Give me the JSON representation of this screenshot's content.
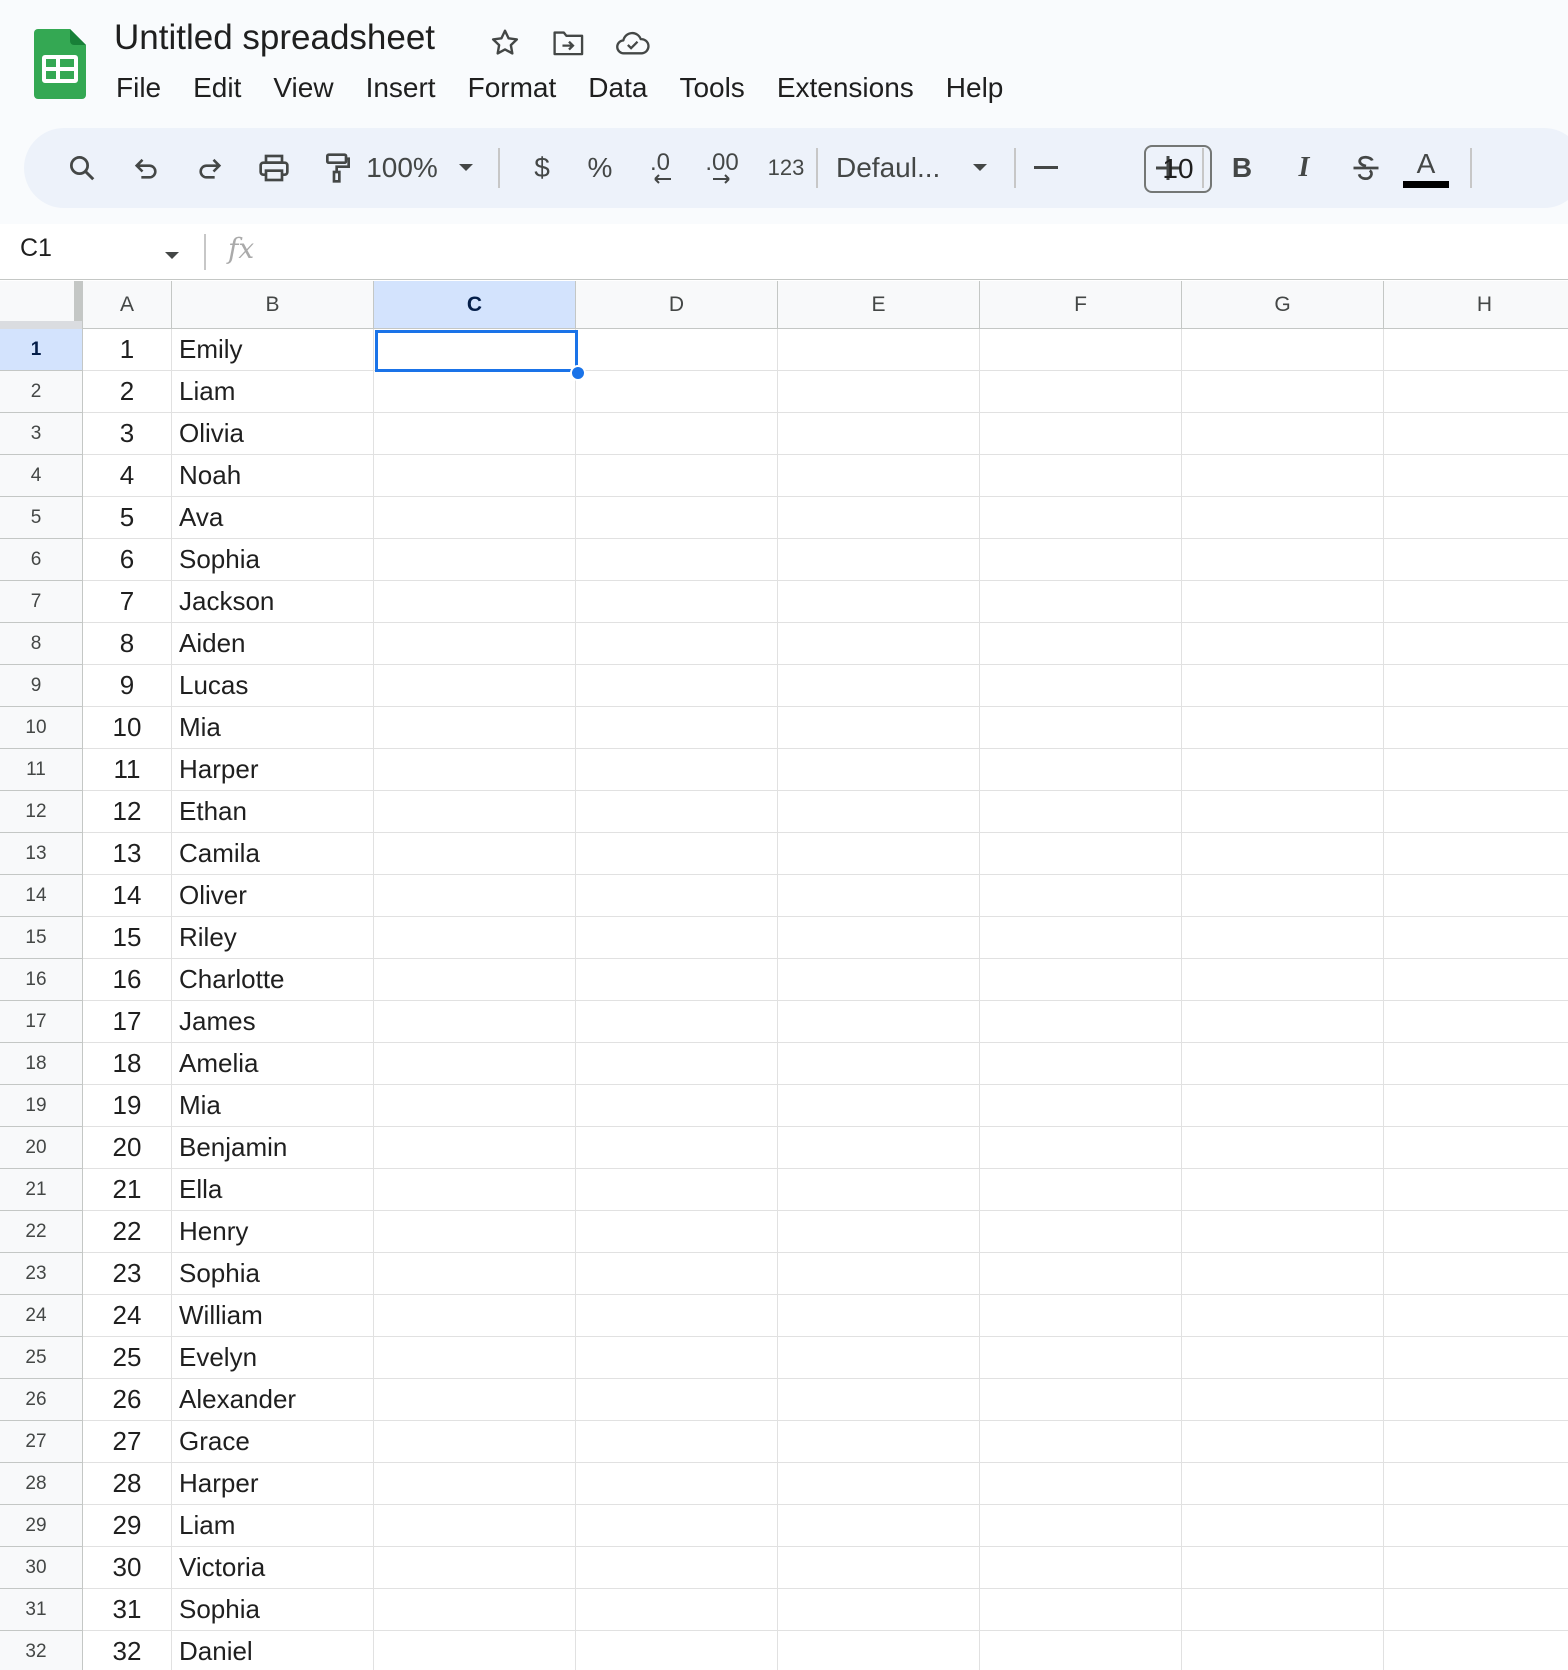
{
  "app": {
    "title": "Untitled spreadsheet",
    "brand_color": "#34a853",
    "accent_color": "#1a73e8",
    "title_icons": [
      "star-icon",
      "move-to-folder-icon",
      "cloud-saved-icon"
    ]
  },
  "menu": [
    "File",
    "Edit",
    "View",
    "Insert",
    "Format",
    "Data",
    "Tools",
    "Extensions",
    "Help"
  ],
  "toolbar": {
    "zoom": "100%",
    "currency": "$",
    "percent": "%",
    "decrease_decimal": ".0",
    "increase_decimal": ".00",
    "more_formats": "123",
    "font": "Defaul...",
    "font_size": "10",
    "minus": "−",
    "plus": "+",
    "bold": "B",
    "italic": "I",
    "text_color": "A",
    "icons": [
      "search-icon",
      "undo-icon",
      "redo-icon",
      "print-icon",
      "paint-format-icon",
      "strikethrough-icon"
    ]
  },
  "formula_bar": {
    "name_box": "C1",
    "fx": "fx",
    "value": ""
  },
  "grid": {
    "columns": [
      "A",
      "B",
      "C",
      "D",
      "E",
      "F",
      "G",
      "H"
    ],
    "selected_column": "C",
    "selected_row": 1,
    "selected_cell": "C1",
    "rows": [
      {
        "n": "1",
        "a": "1",
        "b": "Emily"
      },
      {
        "n": "2",
        "a": "2",
        "b": "Liam"
      },
      {
        "n": "3",
        "a": "3",
        "b": "Olivia"
      },
      {
        "n": "4",
        "a": "4",
        "b": "Noah"
      },
      {
        "n": "5",
        "a": "5",
        "b": "Ava"
      },
      {
        "n": "6",
        "a": "6",
        "b": "Sophia"
      },
      {
        "n": "7",
        "a": "7",
        "b": "Jackson"
      },
      {
        "n": "8",
        "a": "8",
        "b": "Aiden"
      },
      {
        "n": "9",
        "a": "9",
        "b": "Lucas"
      },
      {
        "n": "10",
        "a": "10",
        "b": "Mia"
      },
      {
        "n": "11",
        "a": "11",
        "b": "Harper"
      },
      {
        "n": "12",
        "a": "12",
        "b": "Ethan"
      },
      {
        "n": "13",
        "a": "13",
        "b": "Camila"
      },
      {
        "n": "14",
        "a": "14",
        "b": "Oliver"
      },
      {
        "n": "15",
        "a": "15",
        "b": "Riley"
      },
      {
        "n": "16",
        "a": "16",
        "b": "Charlotte"
      },
      {
        "n": "17",
        "a": "17",
        "b": "James"
      },
      {
        "n": "18",
        "a": "18",
        "b": "Amelia"
      },
      {
        "n": "19",
        "a": "19",
        "b": "Mia"
      },
      {
        "n": "20",
        "a": "20",
        "b": "Benjamin"
      },
      {
        "n": "21",
        "a": "21",
        "b": "Ella"
      },
      {
        "n": "22",
        "a": "22",
        "b": "Henry"
      },
      {
        "n": "23",
        "a": "23",
        "b": "Sophia"
      },
      {
        "n": "24",
        "a": "24",
        "b": "William"
      },
      {
        "n": "25",
        "a": "25",
        "b": "Evelyn"
      },
      {
        "n": "26",
        "a": "26",
        "b": "Alexander"
      },
      {
        "n": "27",
        "a": "27",
        "b": "Grace"
      },
      {
        "n": "28",
        "a": "28",
        "b": "Harper"
      },
      {
        "n": "29",
        "a": "29",
        "b": "Liam"
      },
      {
        "n": "30",
        "a": "30",
        "b": "Victoria"
      },
      {
        "n": "31",
        "a": "31",
        "b": "Sophia"
      },
      {
        "n": "32",
        "a": "32",
        "b": "Daniel"
      }
    ]
  }
}
